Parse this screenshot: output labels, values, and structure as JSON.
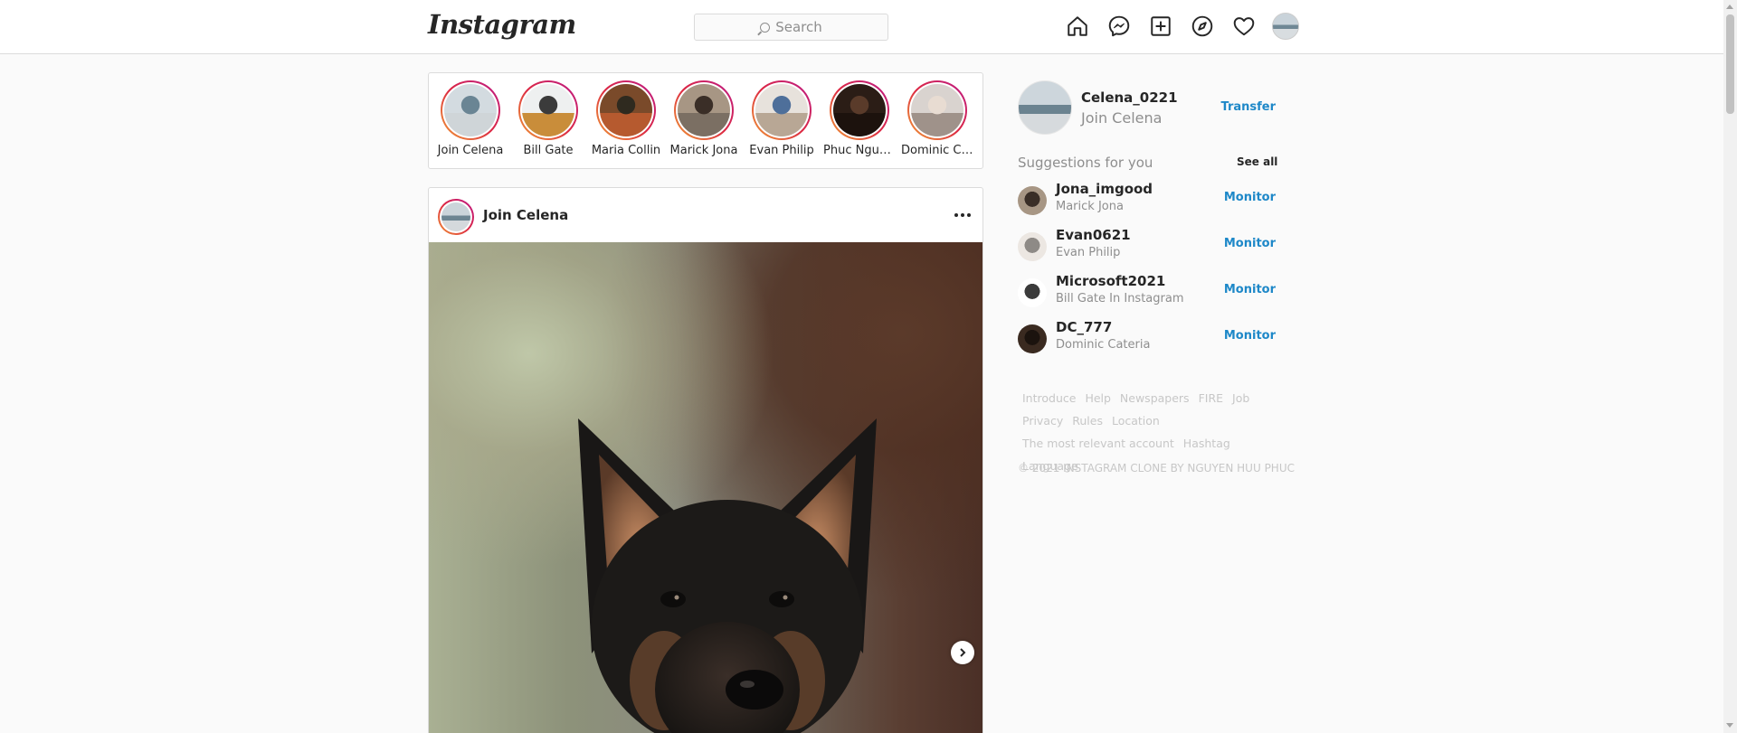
{
  "header": {
    "logo": "Instagram",
    "search_placeholder": "Search",
    "nav_icons": [
      "home-icon",
      "messenger-icon",
      "new-post-icon",
      "explore-icon",
      "activity-heart-icon"
    ]
  },
  "stories": [
    {
      "name": "Join Celena",
      "colors": [
        "#d3dbe0",
        "#6a8594",
        "#cfd5d8"
      ]
    },
    {
      "name": "Bill Gate",
      "colors": [
        "#eef0f0",
        "#3b3b3b",
        "#c98d3a"
      ]
    },
    {
      "name": "Maria Collin",
      "colors": [
        "#7a4a2a",
        "#2f2a1f",
        "#b65a2f"
      ]
    },
    {
      "name": "Marick Jona",
      "colors": [
        "#a79684",
        "#3a2e27",
        "#7b6f63"
      ]
    },
    {
      "name": "Evan Philip",
      "colors": [
        "#e7e2dc",
        "#4e6f9a",
        "#b8a795"
      ]
    },
    {
      "name": "Phuc Nguyen",
      "colors": [
        "#2b1d16",
        "#5a3b2a",
        "#1c120d"
      ]
    },
    {
      "name": "Dominic Cateria",
      "colors": [
        "#d9d3cf",
        "#e8dcd2",
        "#9f928a"
      ]
    }
  ],
  "post": {
    "username": "Join Celena",
    "more_icon": "more-horizontal-icon",
    "next_icon": "chevron-right-icon"
  },
  "profile": {
    "username": "Celena_0221",
    "name": "Join Celena",
    "action": "Transfer"
  },
  "suggestions": {
    "title": "Suggestions for you",
    "see_all": "See all",
    "items": [
      {
        "username": "Jona_imgood",
        "name": "Marick Jona",
        "action": "Monitor",
        "colors": [
          "#a79684",
          "#3a2e27"
        ]
      },
      {
        "username": "Evan0621",
        "name": "Evan Philip",
        "action": "Monitor",
        "colors": [
          "#ece7e2",
          "#8e8a86"
        ]
      },
      {
        "username": "Microsoft2021",
        "name": "Bill Gate In Instagram",
        "action": "Monitor",
        "colors": [
          "#ffffff",
          "#3b3b3b"
        ]
      },
      {
        "username": "DC_777",
        "name": "Dominic Cateria",
        "action": "Monitor",
        "colors": [
          "#3a2a20",
          "#1b130e"
        ]
      }
    ]
  },
  "footer": {
    "links": [
      "Introduce",
      "Help",
      "Newspapers",
      "FIRE",
      "Job",
      "Privacy",
      "Rules",
      "Location",
      "The most relevant account",
      "Hashtag",
      "Language"
    ],
    "copyright": "© 2021 INSTAGRAM CLONE BY NGUYEN HUU PHUC"
  },
  "colors": {
    "accent": "#1e88c8",
    "story_ring": "#dc2743",
    "border": "#dbdbdb"
  }
}
